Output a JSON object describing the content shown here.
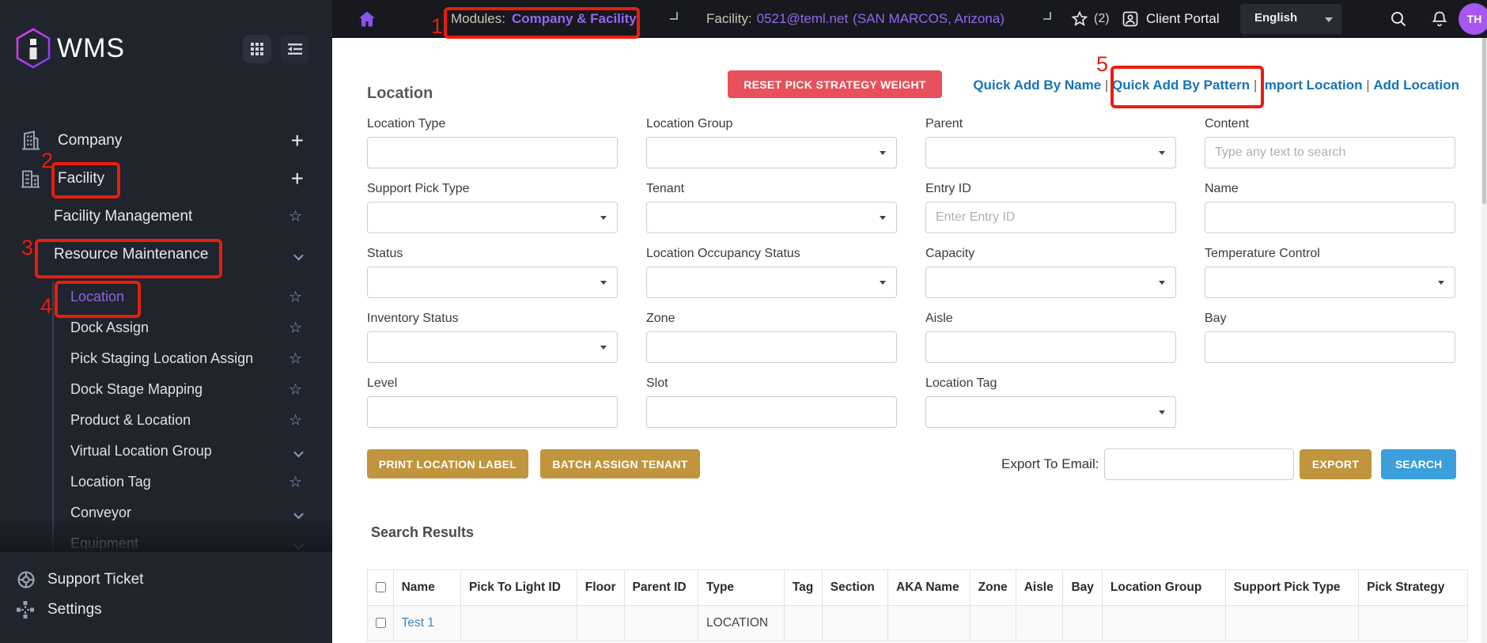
{
  "colors": {
    "sidebar_bg": "#20242d",
    "topbar_bg": "#17191e",
    "accent_purple": "#9467ec",
    "active_purple": "#8a63e0",
    "avatar_bg": "#a557f0",
    "annotation_red": "#ea1d0d",
    "danger_red": "#e8505b",
    "gold": "#c0953e",
    "primary_blue": "#3a9fdc",
    "link_blue": "#1673b8"
  },
  "topbar": {
    "modules_label": "Modules:",
    "modules_value": "Company & Facility",
    "facility_label": "Facility:",
    "facility_value": "0521@teml.net",
    "facility_location": "(SAN MARCOS, Arizona)",
    "star_count": "(2)",
    "client_portal": "Client Portal",
    "language": "English",
    "avatar": "TH"
  },
  "sidebar": {
    "brand": "WMS",
    "menu": [
      {
        "label": "Company",
        "icon": "building",
        "right": "plus"
      },
      {
        "label": "Facility",
        "icon": "building2",
        "right": "plus"
      },
      {
        "label": "Facility Management",
        "right": "star",
        "indent": 1
      },
      {
        "label": "Resource Maintenance",
        "right": "chevron",
        "indent": 1,
        "children": [
          {
            "label": "Location",
            "right": "star",
            "active": true
          },
          {
            "label": "Dock Assign",
            "right": "star"
          },
          {
            "label": "Pick Staging Location Assign",
            "right": "star"
          },
          {
            "label": "Dock Stage Mapping",
            "right": "star"
          },
          {
            "label": "Product & Location",
            "right": "star"
          },
          {
            "label": "Virtual Location Group",
            "right": "chevron"
          },
          {
            "label": "Location Tag",
            "right": "star"
          },
          {
            "label": "Conveyor",
            "right": "chevron"
          },
          {
            "label": "Equipment",
            "right": "chevron",
            "faded": true
          }
        ]
      }
    ],
    "footer": [
      {
        "label": "Support Ticket",
        "icon": "lifering"
      },
      {
        "label": "Settings",
        "icon": "nodes"
      }
    ]
  },
  "page": {
    "title": "Location",
    "reset_button": "RESET PICK STRATEGY WEIGHT",
    "link_separator": "|",
    "links": [
      "Quick Add By Name",
      "Quick Add By Pattern",
      "Import Location",
      "Add Location"
    ]
  },
  "form": {
    "fields": [
      {
        "label": "Location Type",
        "type": "text"
      },
      {
        "label": "Location Group",
        "type": "select"
      },
      {
        "label": "Parent",
        "type": "select"
      },
      {
        "label": "Content",
        "type": "text",
        "placeholder": "Type any text to search"
      },
      {
        "label": "Support Pick Type",
        "type": "select"
      },
      {
        "label": "Tenant",
        "type": "select"
      },
      {
        "label": "Entry ID",
        "type": "text",
        "placeholder": "Enter Entry ID"
      },
      {
        "label": "Name",
        "type": "text"
      },
      {
        "label": "Status",
        "type": "select"
      },
      {
        "label": "Location Occupancy Status",
        "type": "select"
      },
      {
        "label": "Capacity",
        "type": "select"
      },
      {
        "label": "Temperature Control",
        "type": "select"
      },
      {
        "label": "Inventory Status",
        "type": "select"
      },
      {
        "label": "Zone",
        "type": "text"
      },
      {
        "label": "Aisle",
        "type": "text"
      },
      {
        "label": "Bay",
        "type": "text"
      },
      {
        "label": "Level",
        "type": "text"
      },
      {
        "label": "Slot",
        "type": "text"
      },
      {
        "label": "Location Tag",
        "type": "select"
      }
    ],
    "print_button": "PRINT LOCATION LABEL",
    "batch_button": "BATCH ASSIGN TENANT",
    "export_label": "Export To Email:",
    "export_button": "EXPORT",
    "search_button": "SEARCH"
  },
  "results": {
    "title": "Search Results",
    "columns": [
      "Name",
      "Pick To Light ID",
      "Floor",
      "Parent ID",
      "Type",
      "Tag",
      "Section",
      "AKA Name",
      "Zone",
      "Aisle",
      "Bay",
      "Location Group",
      "Support Pick Type",
      "Pick Strategy"
    ],
    "rows": [
      [
        "Test 1",
        "",
        "",
        "",
        "LOCATION",
        "",
        "",
        "",
        "",
        "",
        "",
        "",
        "",
        ""
      ]
    ]
  },
  "annotations": {
    "numbers": [
      "1",
      "2",
      "3",
      "4",
      "5"
    ]
  }
}
